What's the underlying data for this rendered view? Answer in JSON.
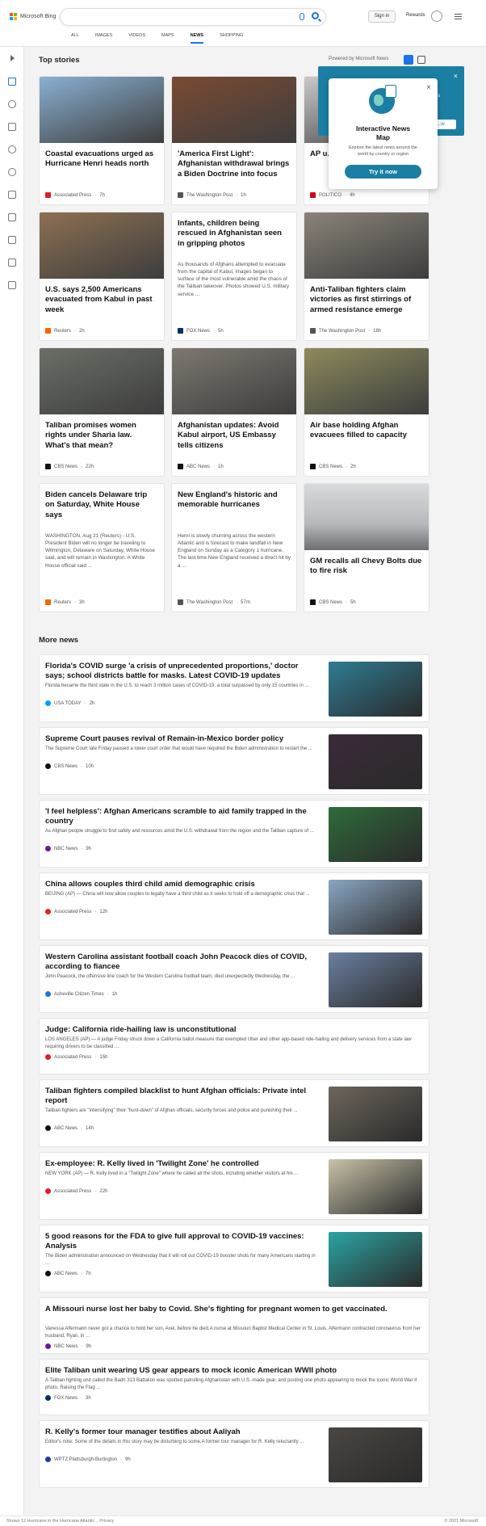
{
  "header": {
    "logo_text": "Microsoft Bing",
    "signin": "Sign in",
    "rewards": "Rewards",
    "tabs": [
      "ALL",
      "IMAGES",
      "VIDEOS",
      "MAPS",
      "NEWS",
      "SHOPPING"
    ],
    "active_tab": "NEWS",
    "brand_colors": [
      "#f25022",
      "#7fba00",
      "#00a4ef",
      "#ffb900"
    ],
    "accent": "#1a73e8"
  },
  "top_stories": {
    "heading": "Top stories",
    "powered_by": "Powered by Microsoft News",
    "cards": [
      {
        "title": "Coastal evacuations urged as Hurricane Henri heads north",
        "snippet": "",
        "source": "Associated Press",
        "time": "7h",
        "logo_color": "#e01e26",
        "image_color": "#8ab0d2"
      },
      {
        "title": "'America First Light': Afghanistan withdrawal brings a Biden Doctrine into focus",
        "snippet": "",
        "source": "The Washington Post",
        "time": "1h",
        "logo_color": "#555555",
        "image_color": "#7a4a33"
      },
      {
        "title": "AP u... bully...",
        "snippet": "",
        "source": "POLITICO",
        "time": "4h",
        "logo_color": "#d0021b",
        "image_color": "#c9c9c9"
      },
      {
        "title": "U.S. says 2,500 Americans evacuated from Kabul in past week",
        "snippet": "",
        "source": "Reuters",
        "time": "2h",
        "logo_color": "#fa6400",
        "image_color": "#8d7052"
      },
      {
        "title": "Infants, children being rescued in Afghanistan seen in gripping photos",
        "snippet": "As thousands of Afghans attempted to evacuate from the capital of Kabul, images began to surface of the most vulnerable amid the chaos of the Taliban takeover. Photos showed U.S. military service ...",
        "source": "FOX News",
        "time": "5h",
        "logo_color": "#003366",
        "image_color": ""
      },
      {
        "title": "Anti-Taliban fighters claim victories as first stirrings of armed resistance emerge",
        "snippet": "",
        "source": "The Washington Post",
        "time": "18h",
        "logo_color": "#555555",
        "image_color": "#8a8378"
      },
      {
        "title": "Taliban promises women rights under Sharia law. What's that mean?",
        "snippet": "",
        "source": "CBS News",
        "time": "22h",
        "logo_color": "#111111",
        "image_color": "#6a6f66"
      },
      {
        "title": "Afghanistan updates: Avoid Kabul airport, US Embassy tells citizens",
        "snippet": "",
        "source": "ABC News",
        "time": "1h",
        "logo_color": "#111111",
        "image_color": "#7e7870"
      },
      {
        "title": "Air base holding Afghan evacuees filled to capacity",
        "snippet": "",
        "source": "CBS News",
        "time": "2h",
        "logo_color": "#111111",
        "image_color": "#8d8a5c"
      },
      {
        "title": "Biden cancels Delaware trip on Saturday, White House says",
        "snippet": "WASHINGTON, Aug 21 (Reuters) - U.S. President Biden will no longer be traveling to Wilmington, Delaware on Saturday, White House said, and will remain in Washington. A White House official said ...",
        "source": "Reuters",
        "time": "3h",
        "logo_color": "#fa6400",
        "image_color": ""
      },
      {
        "title": "New England's historic and memorable hurricanes",
        "snippet": "Henri is slowly churning across the western Atlantic and is forecast to make landfall in New England on Sunday as a Category 1 hurricane. The last time New England received a direct hit by a ...",
        "source": "The Washington Post",
        "time": "57m",
        "logo_color": "#555555",
        "image_color": ""
      },
      {
        "title": "GM recalls all Chevy Bolts due to fire risk",
        "snippet": "",
        "source": "CBS News",
        "time": "5h",
        "logo_color": "#111111",
        "image_color": "#b7b9bd"
      }
    ]
  },
  "map_promo": {
    "callout_text": "...es",
    "callout_button": "...w",
    "title": "Interactive News Map",
    "description": "Explore the latest news around the world by country or region",
    "button": "Try it now",
    "close": "×",
    "color": "#1b7fa3"
  },
  "more_news": {
    "heading": "More news",
    "items": [
      {
        "title": "Florida's COVID surge 'a crisis of unprecedented proportions,' doctor says; school districts battle for masks. Latest COVID-19 updates",
        "snippet": "Florida became the third state in the U.S. to reach 3 million cases of COVID-19, a total surpassed by only 15 countries in ...",
        "source": "USA TODAY",
        "time": "2h",
        "logo_color": "#009bff",
        "image_color": "#2f7c93"
      },
      {
        "title": "Supreme Court pauses revival of Remain-in-Mexico border policy",
        "snippet": "The Supreme Court late Friday paused a lower court order that would have required the Biden administration to restart the ...",
        "source": "CBS News",
        "time": "10h",
        "logo_color": "#111111",
        "image_color": "#3a2a3a"
      },
      {
        "title": "'I feel helpless': Afghan Americans scramble to aid family trapped in the country",
        "snippet": "As Afghan people struggle to find safety and resources amid the U.S. withdrawal from the region and the Taliban capture of ...",
        "source": "NBC News",
        "time": "9h",
        "logo_color": "#6a1b9a",
        "image_color": "#2e6b3a"
      },
      {
        "title": "China allows couples third child amid demographic crisis",
        "snippet": "BEIJING (AP) — China will now allow couples to legally have a third child as it seeks to hold off a demographic crisis that ...",
        "source": "Associated Press",
        "time": "12h",
        "logo_color": "#e01e26",
        "image_color": "#8aa6c2"
      },
      {
        "title": "Western Carolina assistant football coach John Peacock dies of COVID, according to fiancee",
        "snippet": "John Peacock, the offensive line coach for the Western Carolina football team, died unexpectedly Wednesday, the ...",
        "source": "Asheville Citizen Times",
        "time": "1h",
        "logo_color": "#1a73e8",
        "image_color": "#6b7fa0"
      },
      {
        "title": "Judge: California ride-hailing law is unconstitutional",
        "snippet": "LOS ANGELES (AP) — A judge Friday struck down a California ballot measure that exempted Uber and other app-based ride-hailing and delivery services from a state law requiring drivers to be classified ...",
        "source": "Associated Press",
        "time": "15h",
        "logo_color": "#e01e26",
        "image_color": ""
      },
      {
        "title": "Taliban fighters compiled blacklist to hunt Afghan officials: Private intel report",
        "snippet": "Taliban fighters are \"intensifying\" their \"hunt-down\" of Afghan officials, security forces and police and punishing their ...",
        "source": "ABC News",
        "time": "14h",
        "logo_color": "#111111",
        "image_color": "#6e665c"
      },
      {
        "title": "Ex-employee: R. Kelly lived in 'Twilight Zone' he controlled",
        "snippet": "NEW YORK (AP) — R. Kelly lived in a \"Twilight Zone\" where he called all the shots, including whether visitors at his ...",
        "source": "Associated Press",
        "time": "22h",
        "logo_color": "#e01e26",
        "image_color": "#c9c2a8"
      },
      {
        "title": "5 good reasons for the FDA to give full approval to COVID-19 vaccines: Analysis",
        "snippet": "The Biden administration announced on Wednesday that it will roll out COVID-19 booster shots for many Americans starting in ...",
        "source": "ABC News",
        "time": "7h",
        "logo_color": "#111111",
        "image_color": "#2aa5a3"
      },
      {
        "title": "A Missouri nurse lost her baby to Covid. She's fighting for pregnant women to get vaccinated.",
        "snippet": "Vanessa Alfermann never got a chance to hold her son, Axel, before he died.A nurse at Missouri Baptist Medical Center in St. Louis, Alfermann contracted coronavirus from her husband, Ryan, in ...",
        "source": "NBC News",
        "time": "9h",
        "logo_color": "#6a1b9a",
        "image_color": ""
      },
      {
        "title": "Elite Taliban unit wearing US gear appears to mock iconic American WWII photo",
        "snippet": "A Taliban fighting unit called the Badri 313 Battalion was spotted patrolling Afghanistan with U.S.-made gear, and posting one photo appearing to mock the iconic World War II photo, Raising the Flag ...",
        "source": "FOX News",
        "time": "3h",
        "logo_color": "#003366",
        "image_color": ""
      },
      {
        "title": "R. Kelly's former tour manager testifies about Aaliyah",
        "snippet": "Editor's note: Some of the details in this story may be disturbing to some.A former tour manager for R. Kelly reluctantly ...",
        "source": "WPTZ Plattsburgh-Burlington",
        "time": "9h",
        "logo_color": "#1a3f9a",
        "image_color": "#4a4642"
      }
    ]
  },
  "footer": {
    "left": "Shows 12 Hurricane in the Hurricane Atlantic... Privacy",
    "right": "© 2021 Microsoft"
  }
}
